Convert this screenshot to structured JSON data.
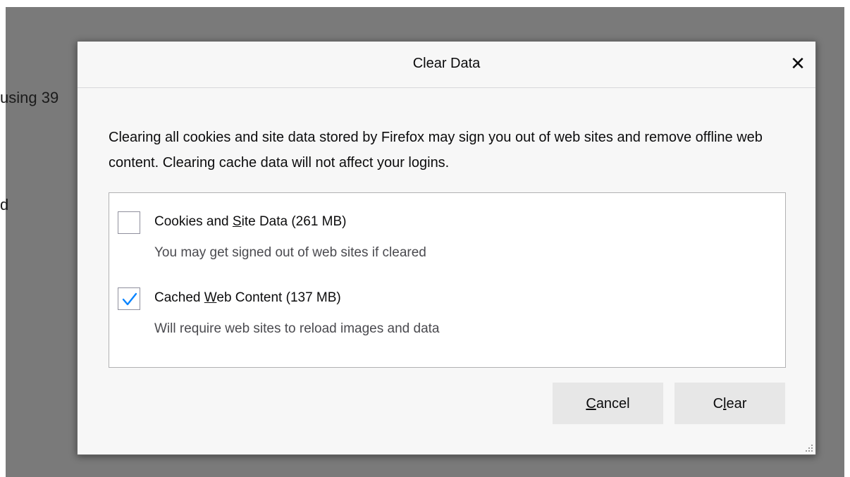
{
  "background": {
    "text_line1": "using 39",
    "text_line2": "d"
  },
  "dialog": {
    "title": "Clear Data",
    "close_icon": "close-icon",
    "close_glyph": "✕",
    "description": "Clearing all cookies and site data stored by Firefox may sign you out of web sites and remove offline web content. Clearing cache data will not affect your logins.",
    "options": [
      {
        "label_pre": "Cookies and ",
        "label_accel": "S",
        "label_post": "ite Data (261 MB)",
        "description": "You may get signed out of web sites if cleared",
        "checked": false
      },
      {
        "label_pre": "Cached ",
        "label_accel": "W",
        "label_post": "eb Content (137 MB)",
        "description": "Will require web sites to reload images and data",
        "checked": true
      }
    ],
    "buttons": {
      "cancel_accel": "C",
      "cancel_rest": "ancel",
      "clear_pre": "C",
      "clear_accel": "l",
      "clear_post": "ear"
    },
    "colors": {
      "checkmark": "#0a84ff",
      "button_bg": "#e7e7e7",
      "backdrop": "#7a7a7a"
    }
  }
}
